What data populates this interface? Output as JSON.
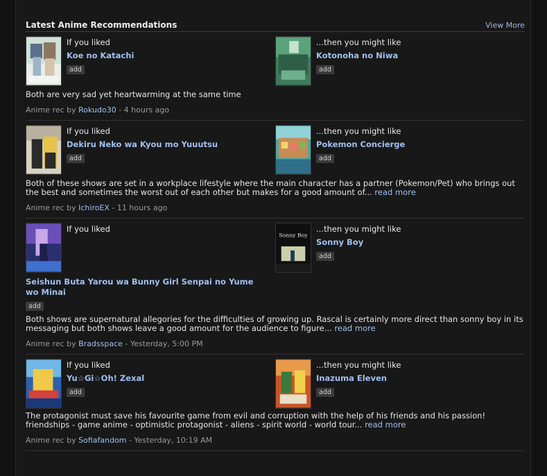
{
  "section": {
    "title": "Latest Anime Recommendations",
    "view_more": "View More"
  },
  "labels": {
    "if_liked": "If you liked",
    "then_like": "...then you might like",
    "add": "add",
    "rec_by": "Anime rec by",
    "read_more": "read more"
  },
  "recs": [
    {
      "liked_title": "Koe no Katachi",
      "like_title": "Kotonoha no Niwa",
      "description": "Both are very sad yet heartwarming at the same time",
      "user": "Rokudo30",
      "time": "- 4 hours ago"
    },
    {
      "liked_title": "Dekiru Neko wa Kyou mo Yuuutsu",
      "like_title": "Pokemon Concierge",
      "description": "Both of these shows are set in a workplace lifestyle where the main character has a partner (Pokemon/Pet) who brings out the best and sometimes the worst out of each other but makes for a good amount of...",
      "user": "IchiroEX",
      "time": "- 11 hours ago"
    },
    {
      "liked_title": "Seishun Buta Yarou wa Bunny Girl Senpai no Yume wo Minai",
      "like_title": "Sonny Boy",
      "description": "Both shows are supernatural allegories for the difficulties of growing up. Rascal is certainly more direct than sonny boy in its messaging but both shows leave a good amount for the audience to figure...",
      "user": "Bradsspace",
      "time": "- Yesterday, 5:00 PM"
    },
    {
      "liked_title": "Yu☆Gi☆Oh! Zexal",
      "like_title": "Inazuma Eleven",
      "description": "The protagonist must save his favourite game from evil and corruption with the help of his friends and his passion! friendships - game anime - optimistic protagonist - aliens - spirit world - world tour...",
      "user": "Sofiafandom",
      "time": "- Yesterday, 10:19 AM"
    }
  ],
  "covers": {
    "sonny_boy_text": "Sonny Boy"
  }
}
